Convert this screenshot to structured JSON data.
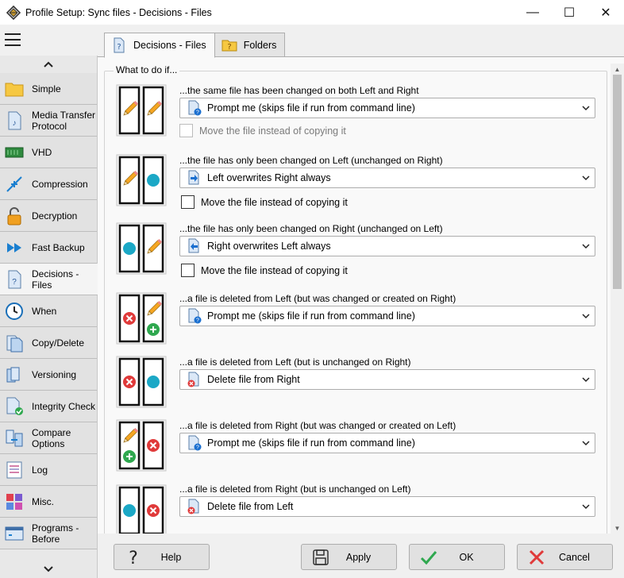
{
  "window": {
    "title": "Profile Setup: Sync files - Decisions - Files",
    "minimize_glyph": "—",
    "maximize_glyph": "☐",
    "close_glyph": "✕"
  },
  "sidebar": {
    "items": [
      {
        "label_lines": [
          "Simple"
        ],
        "icon": "folder-icon"
      },
      {
        "label_lines": [
          "Media Transfer",
          "Protocol"
        ],
        "icon": "media-transfer-icon"
      },
      {
        "label_lines": [
          "VHD"
        ],
        "icon": "vhd-icon"
      },
      {
        "label_lines": [
          "Compression"
        ],
        "icon": "compression-icon"
      },
      {
        "label_lines": [
          "Decryption"
        ],
        "icon": "unlock-icon"
      },
      {
        "label_lines": [
          "Fast Backup"
        ],
        "icon": "fast-forward-icon"
      },
      {
        "label_lines": [
          "Decisions -",
          "Files"
        ],
        "icon": "decision-file-icon",
        "active": true
      },
      {
        "label_lines": [
          "When"
        ],
        "icon": "clock-icon"
      },
      {
        "label_lines": [
          "Copy/Delete"
        ],
        "icon": "copy-delete-icon"
      },
      {
        "label_lines": [
          "Versioning"
        ],
        "icon": "versioning-icon"
      },
      {
        "label_lines": [
          "Integrity Check"
        ],
        "icon": "integrity-check-icon"
      },
      {
        "label_lines": [
          "Compare",
          "Options"
        ],
        "icon": "compare-options-icon"
      },
      {
        "label_lines": [
          "Log"
        ],
        "icon": "log-icon"
      },
      {
        "label_lines": [
          "Misc."
        ],
        "icon": "misc-icon"
      },
      {
        "label_lines": [
          "Programs -",
          "Before"
        ],
        "icon": "programs-before-icon"
      }
    ]
  },
  "tabs": [
    {
      "label": "Decisions - Files",
      "icon": "question-file-icon",
      "active": true
    },
    {
      "label": "Folders",
      "icon": "question-folder-icon",
      "active": false
    }
  ],
  "group_title": "What to do if...",
  "rules": [
    {
      "title": "...the same file has been changed on both Left and Right",
      "selected": "Prompt me (skips file if run from command line)",
      "combo_icon": "prompt-icon",
      "image": "both-changed-icon",
      "move_label": "Move the file instead of copying it",
      "move_enabled": false
    },
    {
      "title": "...the file has only been changed on Left (unchanged on Right)",
      "selected": "Left overwrites Right always",
      "combo_icon": "arrow-right-icon",
      "image": "left-changed-icon",
      "move_label": "Move the file instead of copying it",
      "move_enabled": true
    },
    {
      "title": "...the file has only been changed on Right (unchanged on Left)",
      "selected": "Right overwrites Left always",
      "combo_icon": "arrow-left-icon",
      "image": "right-changed-icon",
      "move_label": "Move the file instead of copying it",
      "move_enabled": true
    },
    {
      "title": "...a file is deleted from Left (but was changed or created on Right)",
      "selected": "Prompt me (skips file if run from command line)",
      "combo_icon": "prompt-icon",
      "image": "deleted-left-changed-right-icon"
    },
    {
      "title": "...a file is deleted from Left (but is unchanged on Right)",
      "selected": "Delete file from Right",
      "combo_icon": "delete-file-icon",
      "image": "deleted-left-unchanged-right-icon"
    },
    {
      "title": "...a file is deleted from Right (but was changed or created on Left)",
      "selected": "Prompt me (skips file if run from command line)",
      "combo_icon": "prompt-icon",
      "image": "deleted-right-changed-left-icon"
    },
    {
      "title": "...a file is deleted from Right (but is unchanged on Left)",
      "selected": "Delete file from Left",
      "combo_icon": "delete-file-icon",
      "image": "deleted-right-unchanged-left-icon"
    }
  ],
  "buttons": {
    "help": "Help",
    "apply": "Apply",
    "ok": "OK",
    "cancel": "Cancel"
  },
  "colors": {
    "accent_blue": "#1a9fe0",
    "teal_circle": "#1ba8c6",
    "red_x": "#e03a3a",
    "green_plus": "#2fa84f",
    "pencil_orange": "#f5a623"
  }
}
